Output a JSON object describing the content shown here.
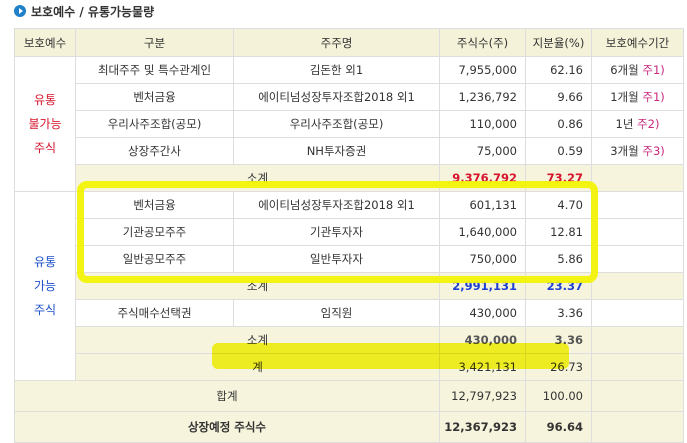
{
  "heading": {
    "title": "보호예수 / 유통가능물량"
  },
  "columns": [
    "보호예수",
    "구분",
    "주주명",
    "주식수(주)",
    "지분율(%)",
    "보호예수기간"
  ],
  "restricted": {
    "group_label": [
      "유통",
      "불가능",
      "주식"
    ],
    "rows": [
      {
        "category": "최대주주 및 특수관계인",
        "holder": "김돈한 외1",
        "shares": "7,955,000",
        "ratio": "62.16",
        "period": "6개월",
        "note": "주1)"
      },
      {
        "category": "벤처금융",
        "holder": "에이티넘성장투자조합2018 외1",
        "shares": "1,236,792",
        "ratio": "9.66",
        "period": "1개월",
        "note": "주1)"
      },
      {
        "category": "우리사주조합(공모)",
        "holder": "우리사주조합(공모)",
        "shares": "110,000",
        "ratio": "0.86",
        "period": "1년",
        "note": "주2)"
      },
      {
        "category": "상장주간사",
        "holder": "NH투자증권",
        "shares": "75,000",
        "ratio": "0.59",
        "period": "3개월",
        "note": "주3)"
      }
    ],
    "subtotal": {
      "label": "소계",
      "shares": "9,376,792",
      "ratio": "73.27"
    }
  },
  "tradable": {
    "group_label": [
      "유통",
      "가능",
      "주식"
    ],
    "rows": [
      {
        "category": "벤처금융",
        "holder": "에이티넘성장투자조합2018 외1",
        "shares": "601,131",
        "ratio": "4.70"
      },
      {
        "category": "기관공모주주",
        "holder": "기관투자자",
        "shares": "1,640,000",
        "ratio": "12.81"
      },
      {
        "category": "일반공모주주",
        "holder": "일반투자자",
        "shares": "750,000",
        "ratio": "5.86"
      }
    ],
    "subtotal1": {
      "label": "소계",
      "shares": "2,991,131",
      "ratio": "23.37"
    },
    "option_row": {
      "category": "주식매수선택권",
      "holder": "임직원",
      "shares": "430,000",
      "ratio": "3.36"
    },
    "subtotal2": {
      "label": "소계",
      "shares": "430,000",
      "ratio": "3.36"
    },
    "total": {
      "label": "계",
      "shares": "3,421,131",
      "ratio": "26.73"
    }
  },
  "grand_total": {
    "label": "합계",
    "shares": "12,797,923",
    "ratio": "100.00"
  },
  "listed": {
    "label": "상장예정 주식수",
    "shares": "12,367,923",
    "ratio": "96.64"
  },
  "colors": {
    "header_bg": "#f4f2d8",
    "restricted_text": "#d7142d",
    "tradable_text": "#1c4fc8",
    "note_text": "#c8287d",
    "highlight": "#f3f300"
  }
}
